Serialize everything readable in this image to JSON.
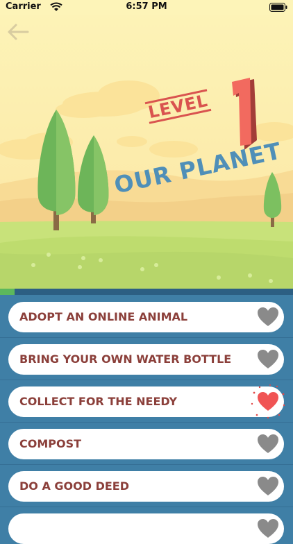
{
  "status_bar": {
    "carrier": "Carrier",
    "time": "6:57 PM"
  },
  "hero": {
    "level_word": "LEVEL",
    "level_number": "1",
    "title": "OUR PLANET"
  },
  "progress": {
    "fraction": 0.05
  },
  "tasks": [
    {
      "label": "ADOPT AN ONLINE ANIMAL",
      "liked": false
    },
    {
      "label": "BRING YOUR OWN WATER BOTTLE",
      "liked": false
    },
    {
      "label": "COLLECT FOR THE NEEDY",
      "liked": true
    },
    {
      "label": "COMPOST",
      "liked": false
    },
    {
      "label": "DO A GOOD DEED",
      "liked": false
    },
    {
      "label": "",
      "liked": false
    }
  ],
  "colors": {
    "heart_off": "#8a8a8a",
    "heart_on": "#f05454",
    "text": "#8b3f3a",
    "list_bg": "#3f7fa6",
    "progress": "#5cb85c"
  }
}
